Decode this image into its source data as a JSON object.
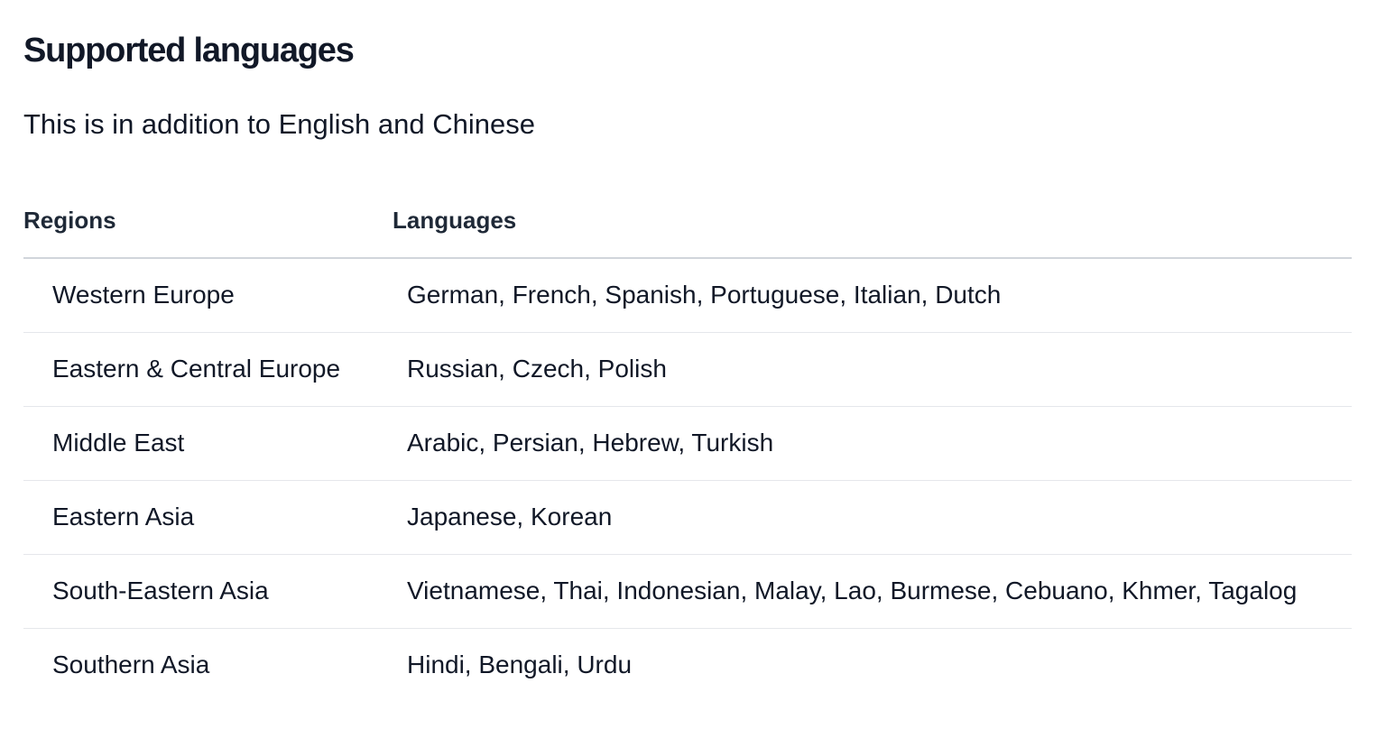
{
  "page": {
    "title": "Supported languages",
    "subtitle": "This is in addition to English and Chinese"
  },
  "table": {
    "headers": {
      "region": "Regions",
      "language": "Languages"
    },
    "rows": [
      {
        "region": "Western Europe",
        "languages": "German, French, Spanish, Portuguese, Italian, Dutch"
      },
      {
        "region": "Eastern & Central Europe",
        "languages": "Russian, Czech, Polish"
      },
      {
        "region": "Middle East",
        "languages": "Arabic, Persian, Hebrew, Turkish"
      },
      {
        "region": "Eastern Asia",
        "languages": "Japanese, Korean"
      },
      {
        "region": "South-Eastern Asia",
        "languages": "Vietnamese, Thai, Indonesian, Malay, Lao, Burmese, Cebuano, Khmer, Tagalog"
      },
      {
        "region": "Southern Asia",
        "languages": "Hindi, Bengali, Urdu"
      }
    ]
  }
}
